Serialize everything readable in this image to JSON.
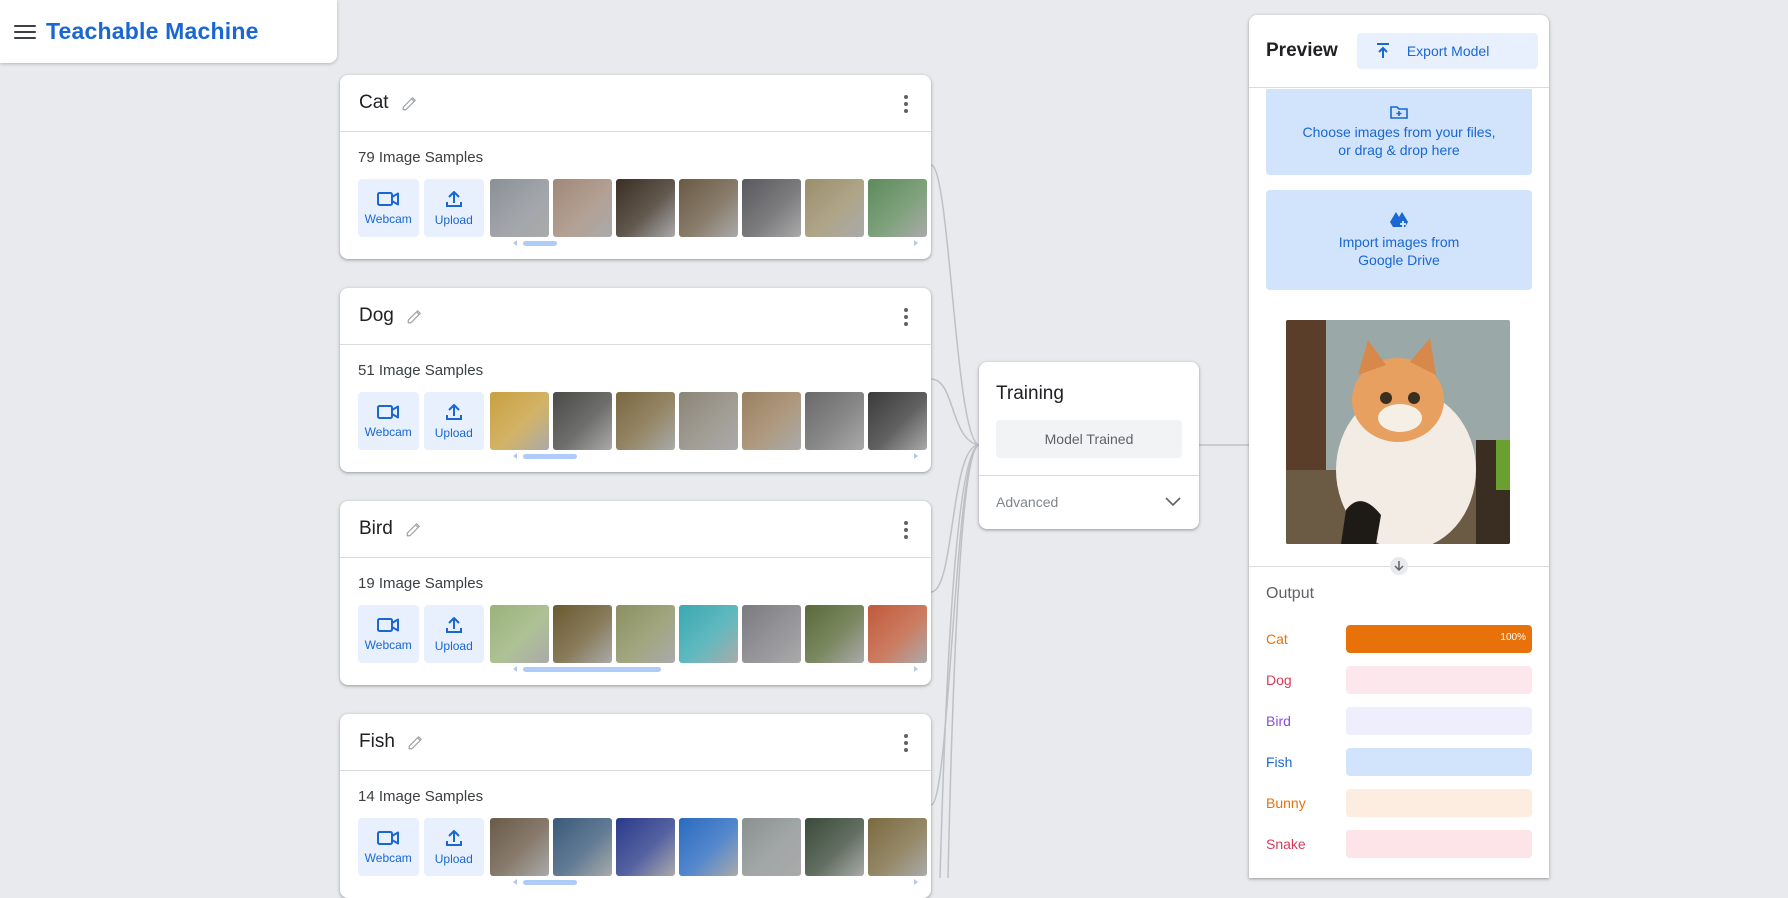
{
  "app": {
    "title": "Teachable Machine",
    "menu_icon": "hamburger-menu-icon"
  },
  "classes": [
    {
      "name": "Cat",
      "sample_count": "79 Image Samples",
      "webcam_label": "Webcam",
      "upload_label": "Upload",
      "thumb_colors": [
        "#8a8f96",
        "#a08878",
        "#3a2e22",
        "#6a5a44",
        "#5a5a5e",
        "#9a8e6a",
        "#5e8a5a"
      ],
      "scroll_fraction": 0.1
    },
    {
      "name": "Dog",
      "sample_count": "51 Image Samples",
      "webcam_label": "Webcam",
      "upload_label": "Upload",
      "thumb_colors": [
        "#c8a040",
        "#4a4a48",
        "#7a6840",
        "#8a8478",
        "#9a8060",
        "#6a6a6a",
        "#3a3a3a"
      ],
      "scroll_fraction": 0.13
    },
    {
      "name": "Bird",
      "sample_count": "19 Image Samples",
      "webcam_label": "Webcam",
      "upload_label": "Upload",
      "thumb_colors": [
        "#9ab27a",
        "#6a5a30",
        "#8a9060",
        "#3aa8b0",
        "#7a7a80",
        "#5a6a3a",
        "#c05a3a"
      ],
      "scroll_fraction": 0.3
    },
    {
      "name": "Fish",
      "sample_count": "14 Image Samples",
      "webcam_label": "Webcam",
      "upload_label": "Upload",
      "thumb_colors": [
        "#6a5a48",
        "#3a5a7a",
        "#2a3a8a",
        "#2a6ac0",
        "#8a9090",
        "#3a4a3a",
        "#7a6a40"
      ],
      "scroll_fraction": 0.2
    }
  ],
  "training": {
    "title": "Training",
    "status_button": "Model Trained",
    "advanced_label": "Advanced"
  },
  "preview": {
    "title": "Preview",
    "export_label": "Export Model",
    "file_drop_text_1": "Choose images from your files,",
    "file_drop_text_2": "or drag & drop here",
    "drive_text_1": "Import images from",
    "drive_text_2": "Google Drive",
    "output_title": "Output",
    "outputs": [
      {
        "label": "Cat",
        "value": 1.0,
        "percent_text": "100%",
        "color": "#e8710a",
        "track": "#fce8d8"
      },
      {
        "label": "Dog",
        "value": 0,
        "percent_text": "",
        "color": "#d93a5a",
        "track": "#fce8ec"
      },
      {
        "label": "Bird",
        "value": 0,
        "percent_text": "",
        "color": "#8a4fd6",
        "track": "#efeefc"
      },
      {
        "label": "Fish",
        "value": 0,
        "percent_text": "",
        "color": "#1967d2",
        "track": "#d2e3fc"
      },
      {
        "label": "Bunny",
        "value": 0,
        "percent_text": "",
        "color": "#e8710a",
        "track": "#fdece0"
      },
      {
        "label": "Snake",
        "value": 0,
        "percent_text": "",
        "color": "#d93a5a",
        "track": "#fce4e8"
      }
    ]
  }
}
